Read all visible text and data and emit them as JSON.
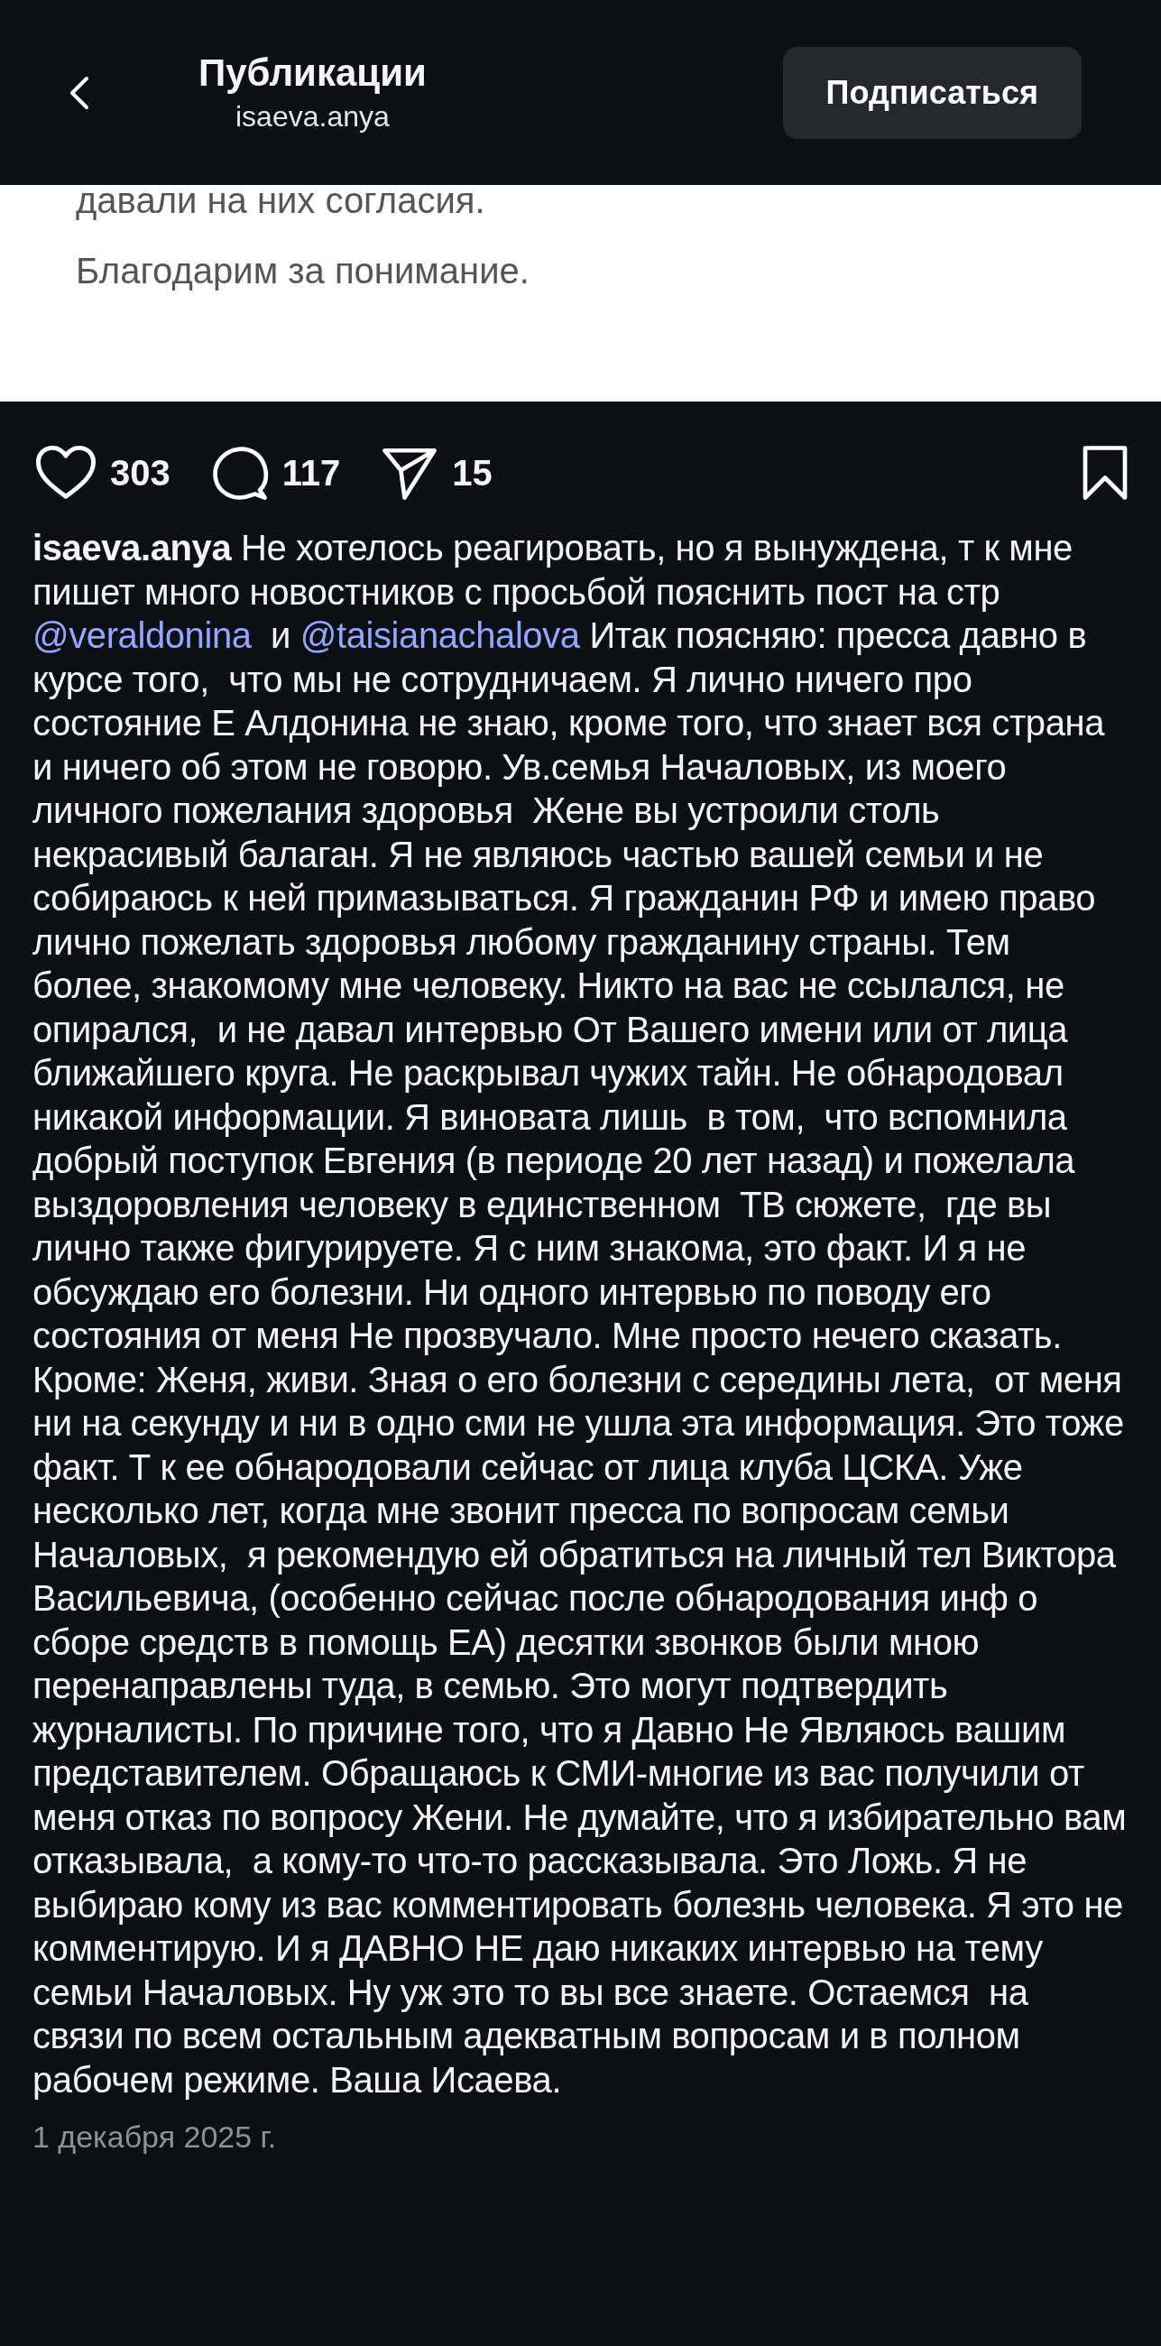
{
  "header": {
    "title": "Публикации",
    "subtitle": "isaeva.anya",
    "follow_button": "Подписаться"
  },
  "post_image": {
    "lines": [
      "давали на них согласия.",
      "Благодарим за понимание."
    ]
  },
  "actions": {
    "likes": "303",
    "comments": "117",
    "shares": "15"
  },
  "caption": [
    {
      "kind": "username",
      "text": "isaeva.anya"
    },
    {
      "kind": "text",
      "text": " Не хотелось реагировать, но я вынуждена, т к мне пишет много новостников с просьбой пояснить пост на стр "
    },
    {
      "kind": "mention",
      "text": "@veraldonina"
    },
    {
      "kind": "text",
      "text": "  и "
    },
    {
      "kind": "mention",
      "text": "@taisianachalova"
    },
    {
      "kind": "text",
      "text": " Итак поясняю: пресса давно в курсе того,  что мы не сотрудничаем. Я лично ничего про состояние Е Алдонина не знаю, кроме того, что знает вся страна и ничего об этом не говорю. Ув.семья Началовых, из моего личного пожелания здоровья  Жене вы устроили столь некрасивый балаган. Я не являюсь частью вашей семьи и не собираюсь к ней примазываться. Я гражданин РФ и имею право лично пожелать здоровья любому гражданину страны. Тем более, знакомому мне человеку. Никто на вас не ссылался, не опирался,  и не давал интервью От Вашего имени или от лица ближайшего круга. Не раскрывал чужих тайн. Не обнародовал никакой информации. Я виновата лишь  в том,  что вспомнила добрый поступок Евгения (в периоде 20 лет назад) и пожелала выздоровления человеку в единственном  ТВ сюжете,  где вы лично также фигурируете. Я с ним знакома, это факт. И я не обсуждаю его болезни. Ни одного интервью по поводу его состояния от меня Не прозвучало. Мне просто нечего сказать. Кроме: Женя, живи. Зная о его болезни с середины лета,  от меня ни на секунду и ни в одно сми не ушла эта информация. Это тоже факт. Т к ее обнародовали сейчас от лица клуба ЦСКА. Уже несколько лет, когда мне звонит пресса по вопросам семьи Началовых,  я рекомендую ей обратиться на личный тел Виктора Васильевича, (особенно сейчас после обнародования инф о сборе средств в помощь ЕА) десятки звонков были мною перенаправлены туда, в семью. Это могут подтвердить журналисты. По причине того, что я Давно Не Являюсь вашим представителем. Обращаюсь к СМИ-многие из вас получили от меня отказ по вопросу Жени. Не думайте, что я избирательно вам отказывала,  а кому-то что-то рассказывала. Это Ложь. Я не выбираю кому из вас комментировать болезнь человека. Я это не комментирую. И я ДАВНО НЕ даю никаких интервью на тему семьи Началовых. Ну уж это то вы все знаете. Остаемся  на связи по всем остальным адекватным вопросам и в полном рабочем режиме. Ваша Исаева."
    }
  ],
  "date": "1 декабря 2025 г."
}
